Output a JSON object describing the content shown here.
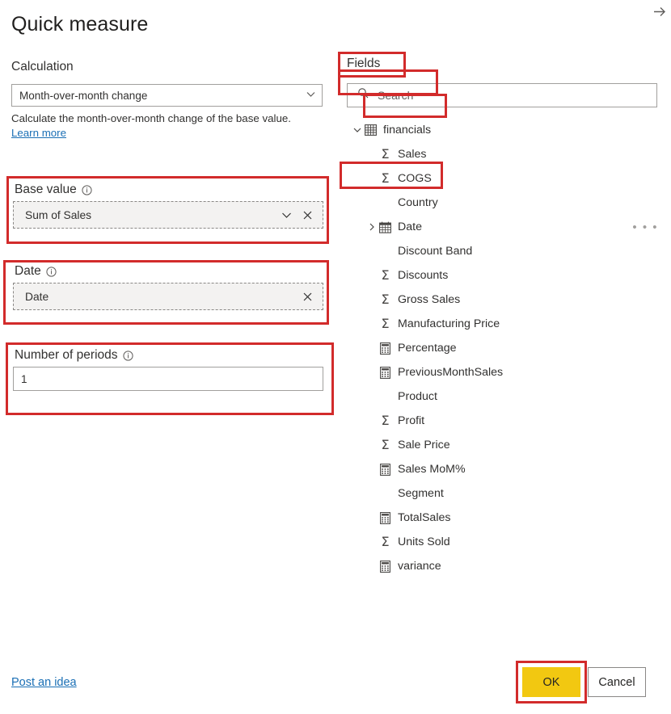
{
  "dialog": {
    "title": "Quick measure",
    "collapse_arrow_icon": "arrow-right-icon"
  },
  "calculation": {
    "label": "Calculation",
    "selected": "Month-over-month change",
    "chevron_icon": "chevron-down-icon",
    "description_prefix": "Calculate the month-over-month change of the base value. ",
    "learn_more": "Learn more"
  },
  "base_value": {
    "label": "Base value",
    "info_icon": "info-icon",
    "value": "Sum of Sales",
    "chevron_icon": "chevron-down-icon",
    "clear_icon": "close-icon"
  },
  "date_well": {
    "label": "Date",
    "info_icon": "info-icon",
    "value": "Date",
    "clear_icon": "close-icon"
  },
  "periods": {
    "label": "Number of periods",
    "info_icon": "info-icon",
    "value": "1",
    "placeholder": ""
  },
  "fields": {
    "label": "Fields",
    "search": {
      "placeholder": "Search",
      "value": "",
      "icon": "search-icon"
    },
    "table": {
      "name": "financials",
      "expand_icon": "chevron-down-icon",
      "table_icon": "table-icon"
    },
    "items": [
      {
        "label": "Sales",
        "icon": "sigma-icon",
        "expandable": false,
        "ellipsis": false
      },
      {
        "label": "COGS",
        "icon": "sigma-icon",
        "expandable": false,
        "ellipsis": false
      },
      {
        "label": "Country",
        "icon": "none",
        "expandable": false,
        "ellipsis": false
      },
      {
        "label": "Date",
        "icon": "calendar-icon",
        "expandable": true,
        "ellipsis": true
      },
      {
        "label": "Discount Band",
        "icon": "none",
        "expandable": false,
        "ellipsis": false
      },
      {
        "label": "Discounts",
        "icon": "sigma-icon",
        "expandable": false,
        "ellipsis": false
      },
      {
        "label": "Gross Sales",
        "icon": "sigma-icon",
        "expandable": false,
        "ellipsis": false
      },
      {
        "label": "Manufacturing Price",
        "icon": "sigma-icon",
        "expandable": false,
        "ellipsis": false
      },
      {
        "label": "Percentage",
        "icon": "calculator-icon",
        "expandable": false,
        "ellipsis": false
      },
      {
        "label": "PreviousMonthSales",
        "icon": "calculator-icon",
        "expandable": false,
        "ellipsis": false
      },
      {
        "label": "Product",
        "icon": "none",
        "expandable": false,
        "ellipsis": false
      },
      {
        "label": "Profit",
        "icon": "sigma-icon",
        "expandable": false,
        "ellipsis": false
      },
      {
        "label": "Sale Price",
        "icon": "sigma-icon",
        "expandable": false,
        "ellipsis": false
      },
      {
        "label": "Sales MoM%",
        "icon": "calculator-icon",
        "expandable": false,
        "ellipsis": false
      },
      {
        "label": "Segment",
        "icon": "none",
        "expandable": false,
        "ellipsis": false
      },
      {
        "label": "TotalSales",
        "icon": "calculator-icon",
        "expandable": false,
        "ellipsis": false
      },
      {
        "label": "Units Sold",
        "icon": "sigma-icon",
        "expandable": false,
        "ellipsis": false
      },
      {
        "label": "variance",
        "icon": "calculator-icon",
        "expandable": false,
        "ellipsis": false
      }
    ]
  },
  "footer": {
    "post_an_idea": "Post an idea",
    "ok": "OK",
    "cancel": "Cancel"
  },
  "colors": {
    "annotation_red": "#d22b2b",
    "ok_yellow": "#f2c811",
    "link_blue": "#1a6fb5",
    "dropzone_fill": "#f3f2f1"
  }
}
